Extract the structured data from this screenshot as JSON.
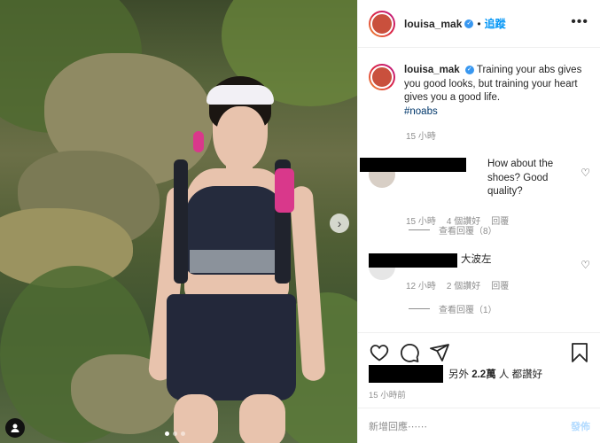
{
  "colors": {
    "accent": "#0095f6",
    "hashtag": "#00376b",
    "muted": "#8e8e8e",
    "text": "#262626"
  },
  "header": {
    "username": "louisa_mak",
    "separator": "•",
    "follow_label": "追蹤",
    "more_icon": "ellipsis-icon"
  },
  "caption": {
    "username": "louisa_mak",
    "text": "Training your abs gives you good looks, but training your heart gives you a good life.",
    "hashtag": "#noabs",
    "time": "15 小時"
  },
  "comments": [
    {
      "text": "How about the shoes? Good quality?",
      "time": "15 小時",
      "likes": "4 個讚好",
      "reply_label": "回覆",
      "view_replies": "查看回覆（8）"
    },
    {
      "text": "大波左",
      "time": "12 小時",
      "likes": "2 個讚好",
      "reply_label": "回覆",
      "view_replies": "查看回覆（1）"
    }
  ],
  "actions": {
    "like_icon": "heart-icon",
    "comment_icon": "comment-icon",
    "share_icon": "send-icon",
    "save_icon": "bookmark-icon"
  },
  "likes": {
    "prefix": "另外",
    "count": "2.2萬",
    "suffix": "人 都讚好"
  },
  "post_time": "15 小時前",
  "add_comment": {
    "placeholder": "新增回應⋯⋯",
    "post_label": "發佈"
  }
}
